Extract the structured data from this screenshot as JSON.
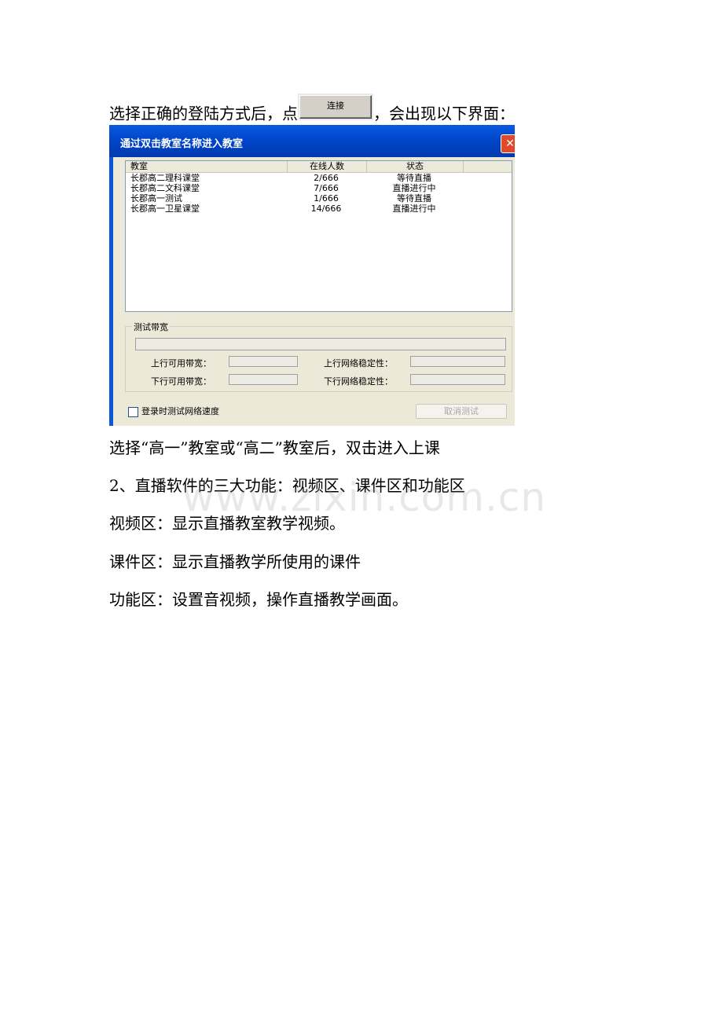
{
  "paragraphs": {
    "p1_before": "选择正确的登陆方式后，点",
    "p1_button": "连接",
    "p1_after": "，会出现以下界面：",
    "p2": "选择“高一”教室或“高二”教室后，双击进入上课",
    "p3": "2、直播软件的三大功能：视频区、课件区和功能区",
    "p4": "视频区：显示直播教室教学视频。",
    "p5": "课件区：显示直播教学所使用的课件",
    "p6": "功能区：设置音视频，操作直播教学画面。"
  },
  "watermark": "www.zixin.com.cn",
  "dialog": {
    "title": "通过双击教室名称进入教室",
    "close_glyph": "✕",
    "columns": [
      "教室",
      "在线人数",
      "状态"
    ],
    "rows": [
      [
        "长郡高二理科课堂",
        "2/666",
        "等待直播"
      ],
      [
        "长郡高二文科课堂",
        "7/666",
        "直播进行中"
      ],
      [
        "长郡高一测试",
        "1/666",
        "等待直播"
      ],
      [
        "长郡高一卫星课堂",
        "14/666",
        "直播进行中"
      ]
    ],
    "group_label": "测试带宽",
    "up_bandwidth": "上行可用带宽：",
    "down_bandwidth": "下行可用带宽：",
    "up_stability": "上行网络稳定性：",
    "down_stability": "下行网络稳定性：",
    "checkbox_label": "登录时测试网络速度",
    "cancel_label": "取消测试"
  },
  "colors": {
    "titlebar": "#0a5ae0",
    "dialog_bg": "#ece9d8",
    "close": "#e04a2a"
  }
}
